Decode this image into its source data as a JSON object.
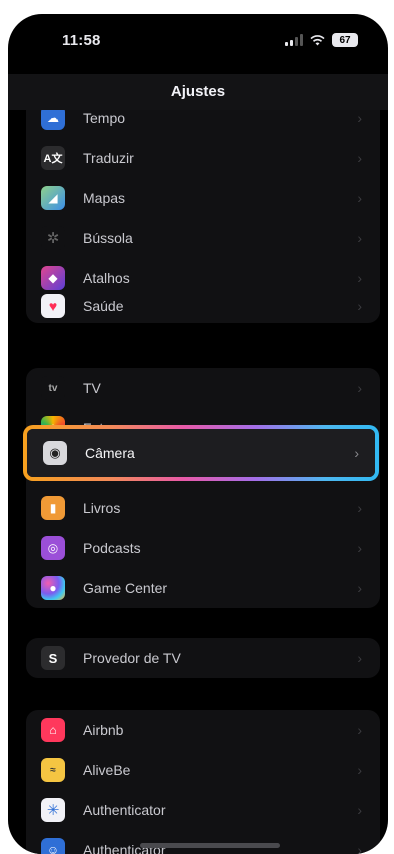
{
  "status_bar": {
    "time": "11:58",
    "battery": "67"
  },
  "nav": {
    "title": "Ajustes"
  },
  "groups": [
    {
      "items": [
        {
          "label": "Tempo",
          "icon": "weather-icon",
          "color": "#2f6fd6"
        },
        {
          "label": "Traduzir",
          "icon": "translate-icon",
          "color": "#1c1c1e"
        },
        {
          "label": "Mapas",
          "icon": "maps-icon",
          "color": "#3b8ee8"
        },
        {
          "label": "Bússola",
          "icon": "compass-icon",
          "color": "#1c1c1e"
        },
        {
          "label": "Atalhos",
          "icon": "shortcuts-icon",
          "color": "#5b3fd6"
        },
        {
          "label": "Saúde",
          "icon": "health-icon",
          "color": "#f2f2f7"
        }
      ]
    },
    {
      "items": [
        {
          "label": "TV",
          "icon": "apple-tv-icon",
          "color": "#1c1c1e"
        },
        {
          "label": "Fotos",
          "icon": "photos-icon",
          "color": "#f2f2f7"
        },
        {
          "label": "Câmera",
          "icon": "camera-icon",
          "color": "#8e8e93"
        },
        {
          "label": "Livros",
          "icon": "books-icon",
          "color": "#f09a36"
        },
        {
          "label": "Podcasts",
          "icon": "podcasts-icon",
          "color": "#9b4fd8"
        },
        {
          "label": "Game Center",
          "icon": "game-center-icon",
          "color": "#e9e9ee"
        }
      ]
    },
    {
      "items": [
        {
          "label": "Provedor de TV",
          "icon": "tv-provider-icon",
          "color": "#2c2c2e"
        }
      ]
    },
    {
      "items": [
        {
          "label": "Airbnb",
          "icon": "airbnb-icon",
          "color": "#ff385c"
        },
        {
          "label": "AliveBe",
          "icon": "alivebe-icon",
          "color": "#f5c542"
        },
        {
          "label": "Authenticator",
          "icon": "authenticator-icon",
          "color": "#f2f2f7"
        },
        {
          "label": "Authenticator",
          "icon": "authenticator-2-icon",
          "color": "#2f6fd6"
        }
      ]
    }
  ],
  "chevron": "›",
  "highlight_colors": [
    "#f7a11e",
    "#e85aa8",
    "#a56ee8",
    "#31b9f2"
  ]
}
